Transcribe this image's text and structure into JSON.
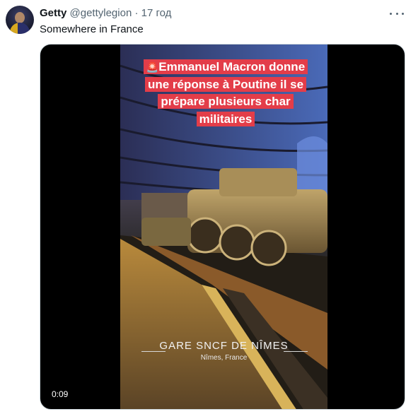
{
  "tweet": {
    "author_name": "Getty",
    "author_handle": "@gettylegion",
    "separator": "·",
    "time": "17 год",
    "text": "Somewhere in France"
  },
  "video": {
    "caption": "Emmanuel Macron donne une réponse à Poutine il se prépare plusieurs char militaires",
    "caption_icon": "siren-icon",
    "location_title": "GARE SNCF DE NÎMES",
    "location_subtitle": "Nîmes, France",
    "elapsed_time": "0:09"
  },
  "colors": {
    "caption_bg": "#e33d49",
    "text_primary": "#0f1419",
    "text_secondary": "#536471"
  }
}
